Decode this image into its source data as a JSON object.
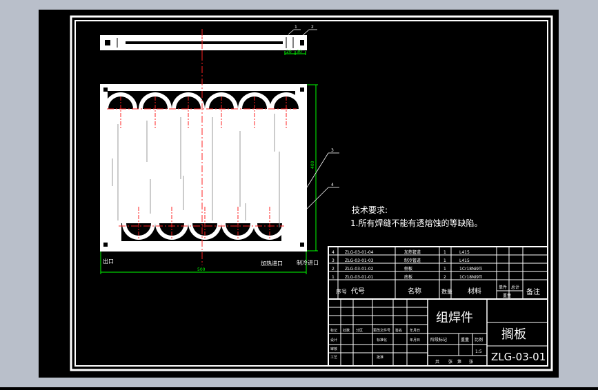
{
  "background": {
    "outer": "#b9bfca",
    "sheet": "#000000",
    "line": "#ffffff",
    "dim": "#00ff00",
    "center": "#ff2020"
  },
  "dimensions": {
    "d20": "20",
    "d30": "30",
    "width": "500",
    "height": "400"
  },
  "callouts": [
    "1",
    "2",
    "3",
    "4"
  ],
  "labels": {
    "outlet": "出口",
    "feed_inlet": "加热进口",
    "coolant_inlet": "制冷进口"
  },
  "tech": {
    "title": "技术要求:",
    "item1": "1.所有焊缝不能有透熔蚀的等缺陷。"
  },
  "bom": [
    {
      "no": "4",
      "code": "ZLG-03-01-04",
      "name": "加热管道",
      "qty": "1",
      "mat": "L415"
    },
    {
      "no": "3",
      "code": "ZLG-03-01-03",
      "name": "制冷管道",
      "qty": "1",
      "mat": "L415"
    },
    {
      "no": "2",
      "code": "ZLG-03-01-02",
      "name": "侧板",
      "qty": "1",
      "mat": "1Cr18Ni9Ti"
    },
    {
      "no": "1",
      "code": "ZLG-03-01-01",
      "name": "底板",
      "qty": "2",
      "mat": "1Cr18Ni9Ti"
    }
  ],
  "bom_header": {
    "no": "序号",
    "code": "代号",
    "name": "名称",
    "qty": "数量",
    "mat": "材料",
    "unit": "单件",
    "total": "总计",
    "weight": "重量",
    "remark": "备注"
  },
  "title_block": {
    "assembly": "组焊件",
    "part_name": "搁板",
    "drawing_no": "ZLG-03-01",
    "scale": "1:5",
    "r_design": "设计",
    "r_std": "标准化",
    "r_check": "审核",
    "r_craft": "工艺",
    "r_mark": "标记",
    "r_count": "处数",
    "r_zone": "分区",
    "r_docno": "更改文件号",
    "r_sign": "签名",
    "r_date": "年月日",
    "r_approve": "批准",
    "stage_mark": "阶段标记",
    "weight": "重量",
    "ratio": "比例",
    "sheets_total": "共",
    "sheet": "张",
    "sheet_no": "第"
  }
}
